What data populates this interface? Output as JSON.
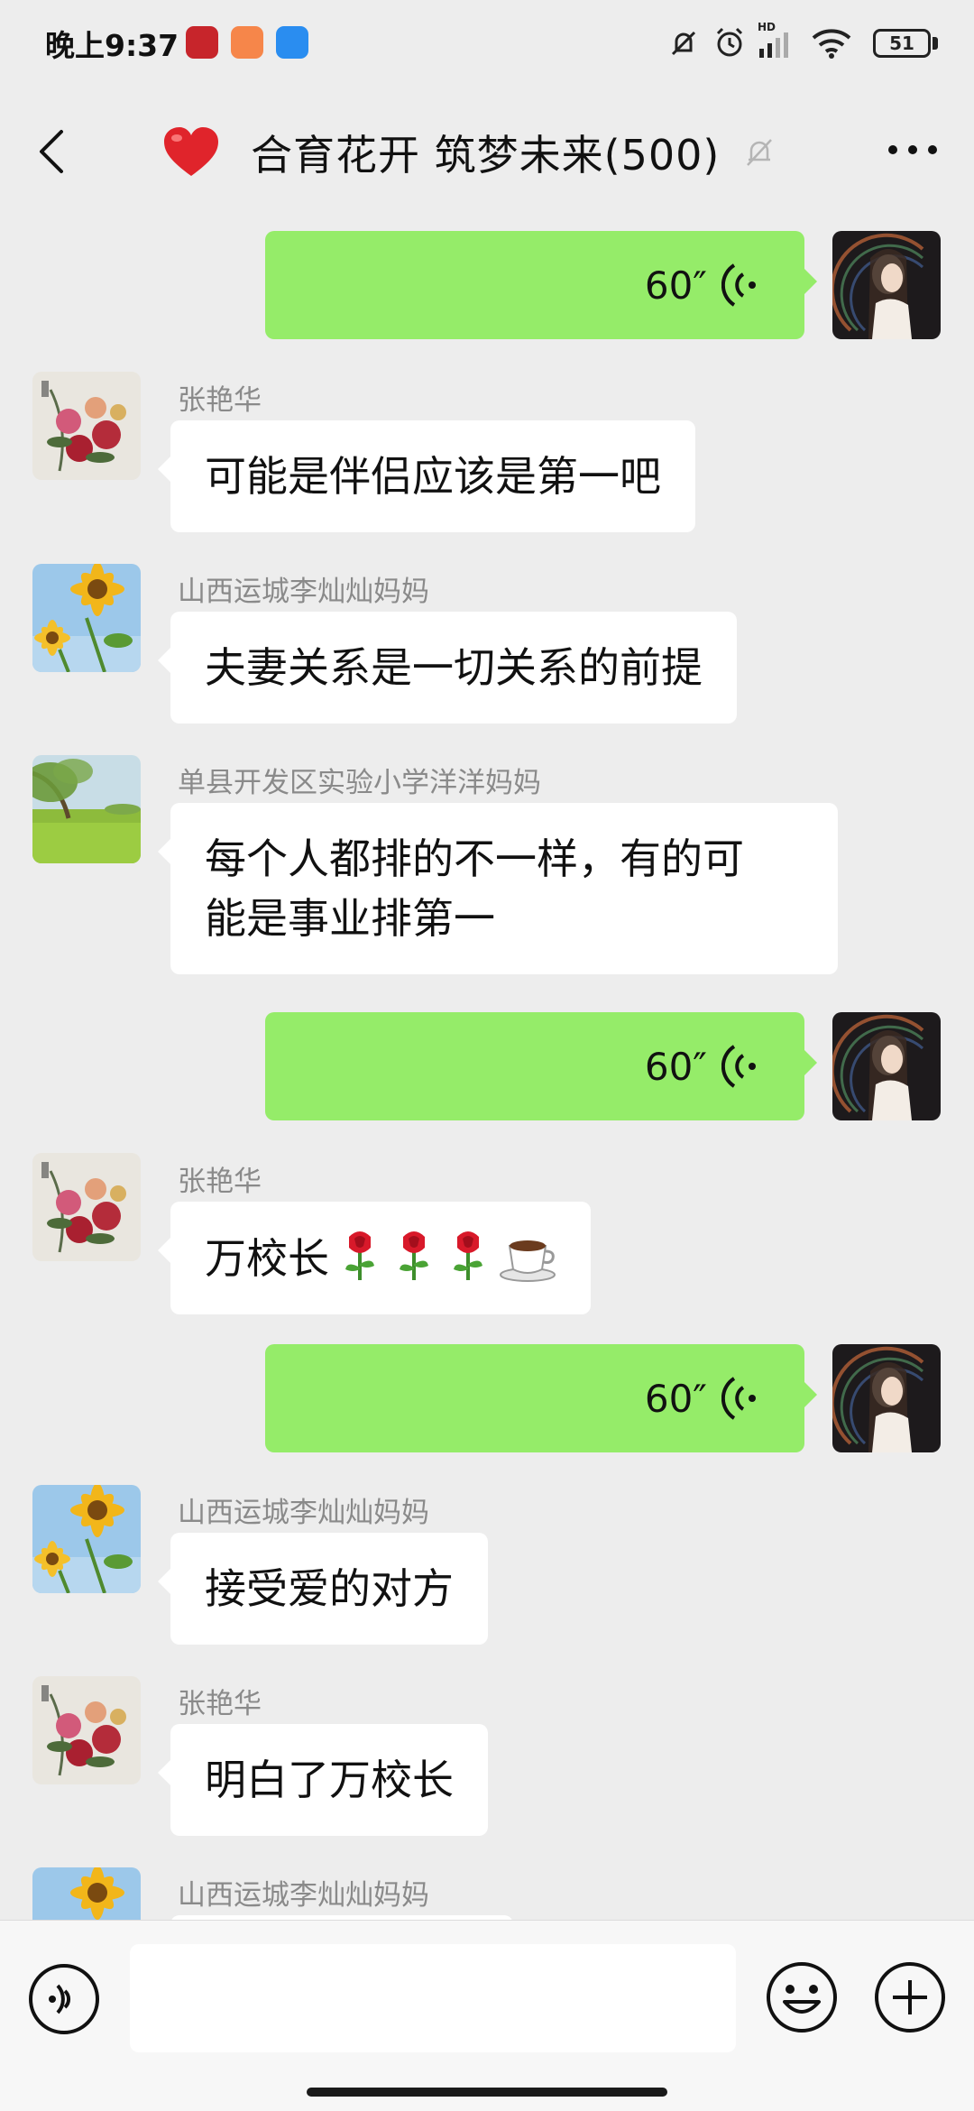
{
  "status_bar": {
    "time": "晚上9:37",
    "battery": "51",
    "app_icons": [
      "news-app-icon",
      "shopping-bag-icon",
      "chat-bubble-app-icon"
    ],
    "icons": [
      "mute-bell-icon",
      "alarm-clock-icon",
      "hd-signal-icon",
      "wifi-icon",
      "battery-icon"
    ]
  },
  "header": {
    "title": "合育花开 筑梦未来(500)",
    "title_emoji": "heart-icon",
    "muted": true,
    "back_icon": "back-arrow-icon",
    "more_icon": "more-dots-icon"
  },
  "messages": [
    {
      "type": "voice",
      "direction": "out",
      "duration": "60″"
    },
    {
      "type": "text",
      "direction": "in",
      "sender": "张艳华",
      "avatar": "peony-painting",
      "text": "可能是伴侣应该是第一吧"
    },
    {
      "type": "text",
      "direction": "in",
      "sender": "山西运城李灿灿妈妈",
      "avatar": "sunflower",
      "text": "夫妻关系是一切关系的前提"
    },
    {
      "type": "text",
      "direction": "in",
      "sender": "单县开发区实验小学洋洋妈妈",
      "avatar": "green-meadow",
      "text_lines": [
        "每个人都排的不一样，有的可",
        "能是事业排第一"
      ]
    },
    {
      "type": "voice",
      "direction": "out",
      "duration": "60″"
    },
    {
      "type": "text",
      "direction": "in",
      "sender": "张艳华",
      "avatar": "peony-painting",
      "text": "万校长",
      "emojis": [
        "rose-icon",
        "rose-icon",
        "rose-icon",
        "coffee-icon"
      ]
    },
    {
      "type": "voice",
      "direction": "out",
      "duration": "60″"
    },
    {
      "type": "text",
      "direction": "in",
      "sender": "山西运城李灿灿妈妈",
      "avatar": "sunflower",
      "text": "接受爱的对方"
    },
    {
      "type": "text",
      "direction": "in",
      "sender": "张艳华",
      "avatar": "peony-painting",
      "text": "明白了万校长"
    },
    {
      "type": "text",
      "direction": "in",
      "sender": "山西运城李灿灿妈妈",
      "avatar": "sunflower",
      "text": ""
    }
  ],
  "input_bar": {
    "placeholder": "",
    "icons": [
      "voice-input-icon",
      "emoji-icon",
      "plus-icon"
    ]
  },
  "colors": {
    "background": "#ededed",
    "outgoing_bubble": "#95ec69",
    "incoming_bubble": "#ffffff",
    "sender_name": "#8a8a8a"
  }
}
